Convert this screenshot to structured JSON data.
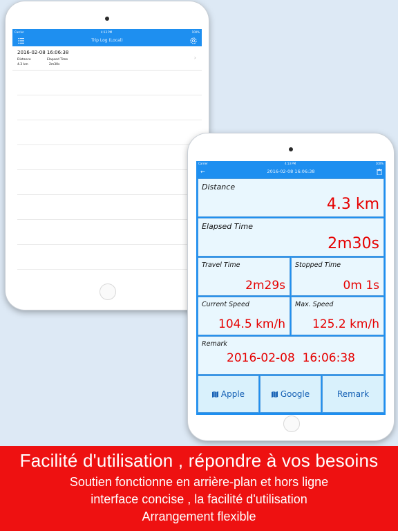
{
  "background_color": "#dde9f5",
  "accent_color": "#1e8ff0",
  "value_color": "#e60000",
  "banner_color": "#ee1111",
  "trip_log": {
    "status_carrier": "Carrier",
    "status_time": "4:13 PM",
    "status_battery": "100%",
    "title": "Trip Log (Local)",
    "menu_icon": "list-icon",
    "settings_icon": "gear-icon",
    "entries": [
      {
        "date": "2016-02-08  16:06:38",
        "distance_label": "Distance",
        "distance": "4.3 km",
        "elapsed_label": "Elapsed Time",
        "elapsed": "2m30s"
      }
    ]
  },
  "trip_detail": {
    "status_carrier": "Carrier",
    "status_time": "4:13 PM",
    "status_battery": "100%",
    "title": "2016-02-08 16:06:38",
    "back_icon": "back-arrow-icon",
    "delete_icon": "trash-icon",
    "distance": {
      "label": "Distance",
      "value": "4.3 km"
    },
    "elapsed": {
      "label": "Elapsed Time",
      "value": "2m30s"
    },
    "travel": {
      "label": "Travel Time",
      "value": "2m29s"
    },
    "stopped": {
      "label": "Stopped Time",
      "value": "0m 1s"
    },
    "current_speed": {
      "label": "Current Speed",
      "value": "104.5 km/h"
    },
    "max_speed": {
      "label": "Max. Speed",
      "value": "125.2 km/h"
    },
    "remark": {
      "label": "Remark",
      "value": "2016-02-08  16:06:38"
    },
    "buttons": {
      "apple": "Apple",
      "google": "Google",
      "remark": "Remark"
    }
  },
  "banner": {
    "headline": "Facilité d'utilisation , répondre à vos besoins",
    "line1": "Soutien fonctionne en arrière-plan et hors ligne",
    "line2": "interface concise , la facilité d'utilisation",
    "line3": "Arrangement flexible"
  }
}
